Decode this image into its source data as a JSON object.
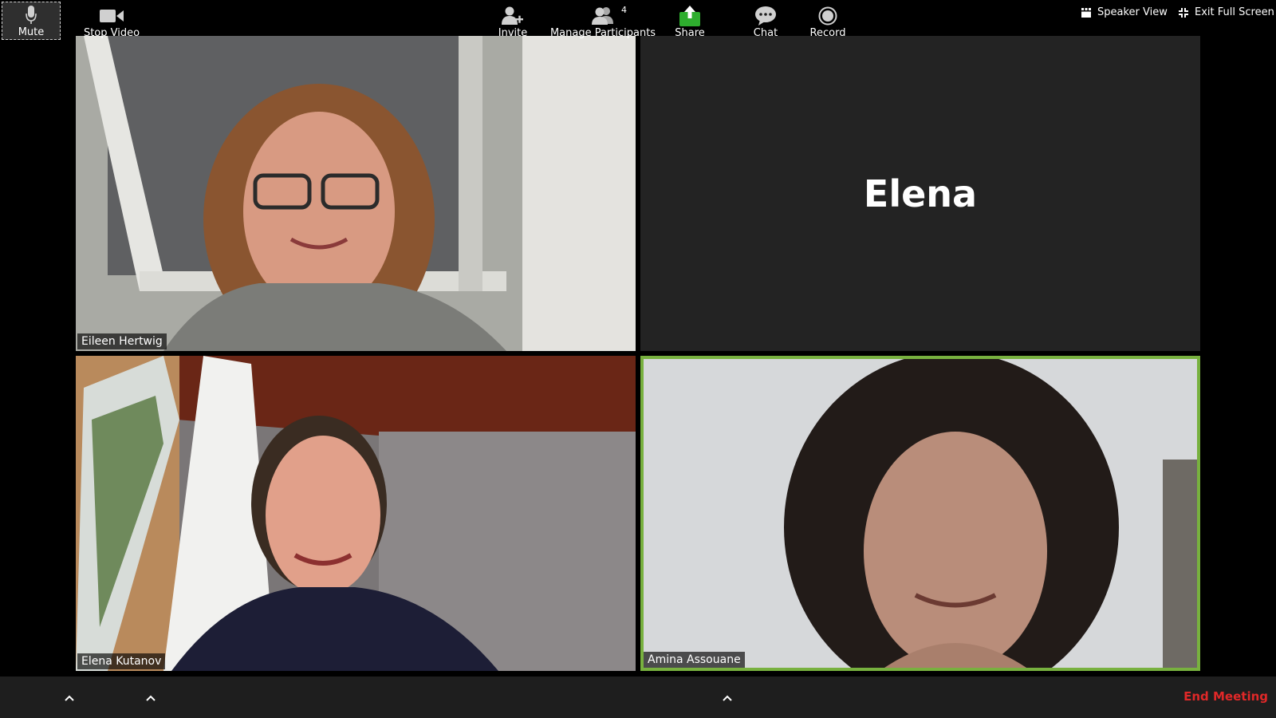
{
  "top_bar": {
    "speaker_view_label": "Speaker View",
    "exit_full_screen_label": "Exit Full Screen",
    "lock_icon": "lock-icon"
  },
  "participants": [
    {
      "name": "Eileen Hertwig",
      "video": true
    },
    {
      "name": "Elena",
      "video": false,
      "display_name": "Elena"
    },
    {
      "name": "Elena Kutanov",
      "video": true
    },
    {
      "name": "Amina Assouane",
      "video": true,
      "active_speaker": true
    }
  ],
  "toolbar": {
    "mute_label": "Mute",
    "stop_video_label": "Stop Video",
    "invite_label": "Invite",
    "manage_participants_label": "Manage Participants",
    "participant_count": "4",
    "share_label": "Share",
    "chat_label": "Chat",
    "record_label": "Record",
    "end_meeting_label": "End Meeting"
  },
  "colors": {
    "background": "#000000",
    "tile_empty": "#232323",
    "active_speaker_border": "#78b13f",
    "share_green": "#2ead2e",
    "end_meeting_red": "#e02828",
    "lock_green": "#2ead2e"
  }
}
